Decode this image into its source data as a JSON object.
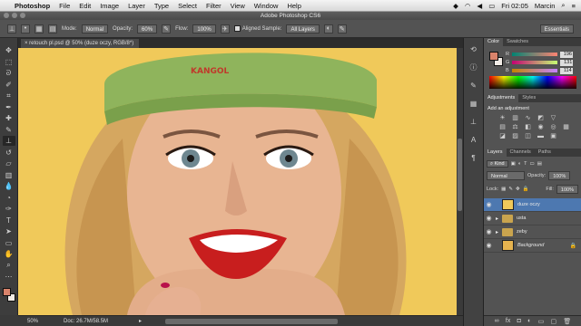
{
  "menubar": {
    "app_name": "Photoshop",
    "items": [
      "File",
      "Edit",
      "Image",
      "Layer",
      "Type",
      "Select",
      "Filter",
      "View",
      "Window",
      "Help"
    ],
    "clock": "Fri 02:05",
    "user": "Marcin"
  },
  "window": {
    "title": "Adobe Photoshop CS6"
  },
  "options": {
    "mode_label": "Mode:",
    "mode_value": "Normal",
    "opacity_label": "Opacity:",
    "opacity_value": "60%",
    "flow_label": "Flow:",
    "flow_value": "100%",
    "aligned_label": "Aligned Sample:",
    "sample_value": "All Layers",
    "workspace": "Essentials"
  },
  "document": {
    "tab_title": "retouch pl.psd @ 50% (duze oczy, RGB/8*)",
    "zoom": "50%",
    "doc_size": "Doc: 26.7M/58.5M"
  },
  "color_panel": {
    "tabs": [
      "Color",
      "Swatches"
    ],
    "r_label": "R",
    "r_value": "196",
    "g_label": "G",
    "g_value": "131",
    "b_label": "B",
    "b_value": "114",
    "fg_color": "#d9836b"
  },
  "adjustments_panel": {
    "tabs": [
      "Adjustments",
      "Styles"
    ],
    "title": "Add an adjustment"
  },
  "layers_panel": {
    "tabs": [
      "Layers",
      "Channels",
      "Paths"
    ],
    "kind_label": "Kind",
    "blend_mode": "Normal",
    "opacity_label": "Opacity:",
    "opacity_value": "100%",
    "lock_label": "Lock:",
    "fill_label": "Fill:",
    "fill_value": "100%",
    "layers": [
      {
        "name": "duze oczy",
        "type": "layer",
        "selected": true
      },
      {
        "name": "usta",
        "type": "group",
        "selected": false
      },
      {
        "name": "zeby",
        "type": "group",
        "selected": false
      },
      {
        "name": "Background",
        "type": "layer",
        "selected": false,
        "locked": true
      }
    ]
  },
  "canvas": {
    "background_color": "#f0c95a",
    "cap_logo_text": "KANGOL"
  }
}
